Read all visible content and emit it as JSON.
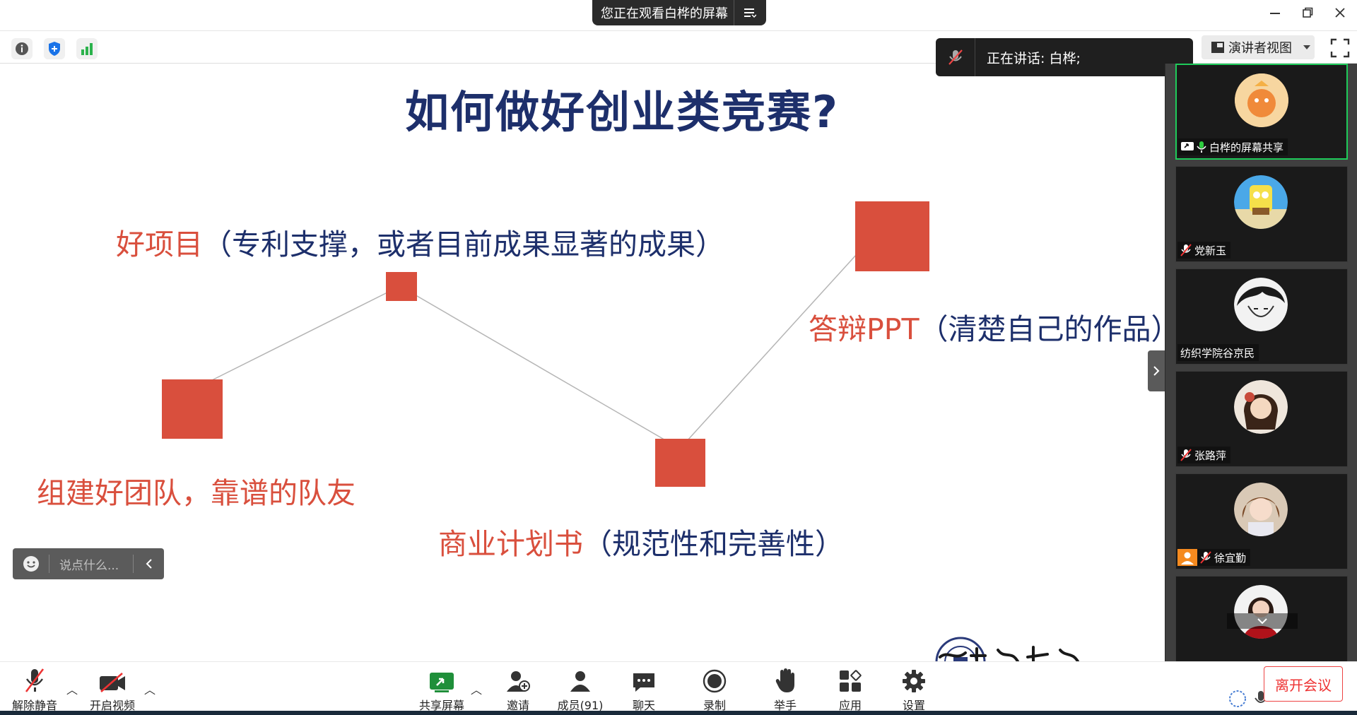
{
  "banner": {
    "text": "您正在观看白桦的屏幕",
    "menu_icon": "menu-icon"
  },
  "speaker_popup": {
    "text": "正在讲话: 白桦;"
  },
  "view_mode": {
    "label": "演讲者视图"
  },
  "slide": {
    "title": "如何做好创业类竞赛?",
    "items": [
      {
        "red": "好项目",
        "navy": "（专利支撑，或者目前成果显著的成果）"
      },
      {
        "red": "答辩PPT",
        "navy": "（清楚自己的作品）"
      },
      {
        "red": "组建好团队，靠谱的队友",
        "navy": ""
      },
      {
        "red": "商业计划书",
        "navy": "（规范性和完善性）"
      }
    ],
    "accent_red": "#d94f3d",
    "title_navy": "#1d2f6b"
  },
  "chat_pill": {
    "placeholder": "说点什么..."
  },
  "participants": [
    {
      "name": "白桦的屏幕共享",
      "muted": false,
      "sharing": true,
      "active": true
    },
    {
      "name": "党新玉",
      "muted": true
    },
    {
      "name": "纺织学院谷京民",
      "muted": false
    },
    {
      "name": "张路萍",
      "muted": true
    },
    {
      "name": "徐宜勤",
      "muted": true
    },
    {
      "name": "",
      "muted": false
    }
  ],
  "toolbar": {
    "unmute": "解除静音",
    "video": "开启视频",
    "share": "共享屏幕",
    "invite": "邀请",
    "members": "成员(91)",
    "chat": "聊天",
    "record": "录制",
    "raise_hand": "举手",
    "apps": "应用",
    "settings": "设置",
    "leave": "离开会议"
  },
  "colors": {
    "active_border": "#1ecb5a",
    "leave_red": "#e33333"
  }
}
